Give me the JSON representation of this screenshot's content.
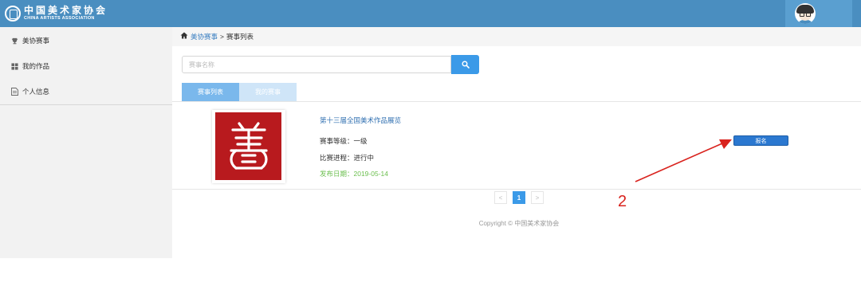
{
  "header": {
    "logo_cn": "中国美术家协会",
    "logo_en": "CHINA ARTISTS ASSOCIATION",
    "colors": {
      "bar": "#4a8ec0",
      "avatar_box": "#5a9fd0"
    }
  },
  "sidebar": {
    "items": [
      {
        "label": "美协赛事",
        "icon": "trophy-icon"
      },
      {
        "label": "我的作品",
        "icon": "grid-icon"
      },
      {
        "label": "个人信息",
        "icon": "document-icon"
      }
    ]
  },
  "breadcrumb": {
    "icon": "home-icon",
    "parent": "美协赛事",
    "separator": ">",
    "current": "赛事列表"
  },
  "search": {
    "placeholder": "赛事名称",
    "icon": "search-icon"
  },
  "tabs": [
    {
      "label": "赛事列表",
      "active": true
    },
    {
      "label": "我的赛事",
      "active": false
    }
  ],
  "competition": {
    "title": "第十三届全国美术作品展览",
    "level": "赛事等级：一级",
    "progress": "比赛进程：进行中",
    "date": "发布日期：2019-05-14",
    "signup_label": "报名"
  },
  "pagination": {
    "prev": "<",
    "current": "1",
    "next": ">"
  },
  "annotation": {
    "number": "2",
    "color": "#d9231e"
  },
  "footer": {
    "copyright": "Copyright © 中国美术家协会"
  },
  "colors": {
    "accent": "#3b9ae8",
    "link": "#3a7fc1",
    "date": "#6bbf4e",
    "seal_red": "#b81a1e"
  }
}
